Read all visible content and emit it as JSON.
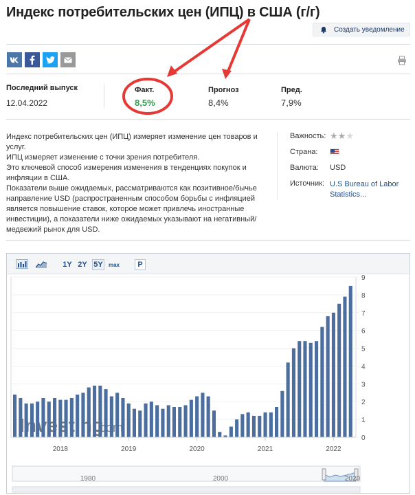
{
  "header": {
    "title": "Индекс потребительских цен (ИПЦ) в США (г/г)",
    "alert_button": "Создать уведомление"
  },
  "share": {
    "buttons": [
      {
        "name": "vk",
        "label": "vk",
        "color": "#4a76a8"
      },
      {
        "name": "facebook",
        "label": "f",
        "color": "#3b5998"
      },
      {
        "name": "twitter",
        "label": "t",
        "color": "#1da1f2"
      },
      {
        "name": "email",
        "label": "✉",
        "color": "#9a9a9a"
      }
    ]
  },
  "release": {
    "label": "Последний выпуск",
    "date": "12.04.2022",
    "actual_label": "Факт.",
    "actual_value": "8,5%",
    "forecast_label": "Прогноз",
    "forecast_value": "8,4%",
    "previous_label": "Пред.",
    "previous_value": "7,9%"
  },
  "description": [
    "Индекс потребительских цен (ИПЦ) измеряет изменение цен товаров и услуг.",
    "ИПЦ измеряет изменение с точки зрения потребителя.",
    "Это ключевой способ измерения изменения в тенденциях покупок и инфляции в США.",
    "Показатели выше ожидаемых, рассматриваются как позитивное/бычье направление USD (распространенным способом борьбы с инфляцией является повышение ставок, которое может привлечь иностранные инвестиции), а показатели ниже ожидаемых указывают на негативный/медвежий рынок для USD."
  ],
  "meta": {
    "importance_label": "Важность:",
    "importance_stars": 2,
    "importance_max": 3,
    "country_label": "Страна:",
    "country_flag": "us-flag-icon",
    "currency_label": "Валюта:",
    "currency_value": "USD",
    "source_label": "Источник:",
    "source_value": "U.S Bureau of Labor Statistics..."
  },
  "chart_toolbar": {
    "ranges": [
      "1Y",
      "2Y",
      "5Y",
      "max"
    ],
    "selected_range": "5Y",
    "p_button": "P"
  },
  "watermark": {
    "brand": "Investing",
    "suffix": ".com"
  },
  "colors": {
    "bar": "#4b6e9e",
    "actual_green": "#2aa14c",
    "annotation_red": "#e53935",
    "navigator_fill": "#cfe0f0"
  },
  "chart_data": {
    "type": "bar",
    "xlabel": "",
    "ylabel": "",
    "ylim": [
      0,
      9
    ],
    "y_ticks": [
      "0",
      "1",
      "2",
      "3",
      "4",
      "5",
      "6",
      "7",
      "8",
      "9"
    ],
    "x_ticks": [
      "2018",
      "2019",
      "2020",
      "2021",
      "2022"
    ],
    "start": "2017-05",
    "values": [
      2.4,
      2.2,
      1.9,
      1.9,
      2.0,
      2.2,
      2.0,
      2.2,
      2.1,
      2.1,
      2.2,
      2.4,
      2.5,
      2.8,
      2.9,
      2.9,
      2.7,
      2.3,
      2.5,
      2.2,
      1.9,
      1.6,
      1.5,
      1.9,
      2.0,
      1.8,
      1.6,
      1.8,
      1.7,
      1.7,
      1.8,
      2.1,
      2.3,
      2.5,
      2.3,
      1.5,
      0.3,
      0.1,
      0.6,
      1.0,
      1.3,
      1.4,
      1.2,
      1.2,
      1.4,
      1.4,
      1.7,
      2.6,
      4.2,
      5.0,
      5.4,
      5.4,
      5.3,
      5.4,
      6.2,
      6.8,
      7.0,
      7.5,
      7.9,
      8.5
    ],
    "navigator": {
      "x_ticks": [
        "1980",
        "2000",
        "2020"
      ]
    }
  }
}
